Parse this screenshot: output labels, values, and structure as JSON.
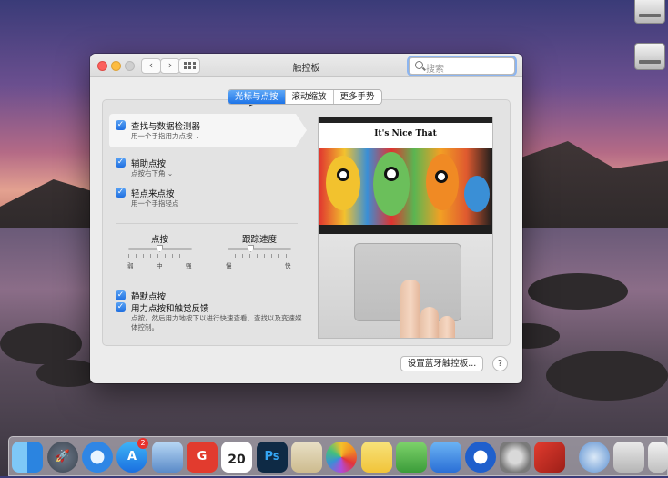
{
  "window": {
    "title": "触控板",
    "search_placeholder": "搜索"
  },
  "tabs": [
    {
      "label": "光标与点按",
      "active": true
    },
    {
      "label": "滚动缩放",
      "active": false
    },
    {
      "label": "更多手势",
      "active": false
    }
  ],
  "options": [
    {
      "title": "查找与数据检测器",
      "subtitle": "用一个手指用力点按",
      "checked": true,
      "has_dropdown": true
    },
    {
      "title": "辅助点按",
      "subtitle": "点按右下角",
      "checked": true,
      "has_dropdown": true
    },
    {
      "title": "轻点来点按",
      "subtitle": "用一个手指轻点",
      "checked": true,
      "has_dropdown": false
    }
  ],
  "sliders": {
    "click": {
      "label": "点按",
      "ticks": [
        "弱",
        "中",
        "强"
      ],
      "value": 0.5
    },
    "tracking": {
      "label": "跟踪速度",
      "min_label": "慢",
      "max_label": "快",
      "value": 0.4
    }
  },
  "bottom_options": [
    {
      "title": "静默点按",
      "checked": true
    },
    {
      "title": "用力点按和触觉反馈",
      "checked": true,
      "description": "点按，然后用力地按下以进行快速查看、查找以及变速媒体控制。"
    }
  ],
  "preview": {
    "site_title": "It's Nice That"
  },
  "buttons": {
    "bluetooth": "设置蓝牙触控板...",
    "help": "?"
  },
  "dock_icons": [
    "finder-icon",
    "launchpad-icon",
    "safari-icon",
    "app-store-icon",
    "preview-icon",
    "foxit-icon",
    "calendar-icon",
    "photoshop-icon",
    "mail-icon",
    "photos-icon",
    "notes-icon",
    "numbers-icon",
    "keynote-icon",
    "quicktime-icon",
    "system-preferences-icon",
    "parallels-icon",
    "downloads-icon",
    "folder-icon",
    "trash-icon"
  ],
  "calendar_date": "20",
  "app_store_badge": "2"
}
